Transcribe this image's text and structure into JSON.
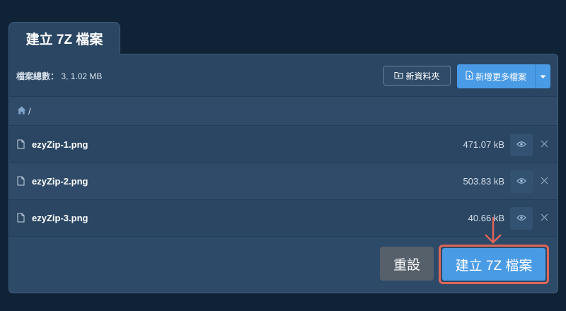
{
  "tab": {
    "title": "建立 7Z 檔案"
  },
  "toolbar": {
    "file_count_label": "檔案總數：",
    "file_count_value": "3, 1.02 MB",
    "new_folder_label": "新資料夾",
    "add_more_label": "新增更多檔案",
    "icons": {
      "new_folder": "folder-plus-icon",
      "add_more": "file-plus-icon",
      "dropdown": "caret-down-icon"
    }
  },
  "breadcrumb": {
    "path": "/",
    "icon": "home-icon"
  },
  "files": [
    {
      "name": "ezyZip-1.png",
      "size": "471.07 kB"
    },
    {
      "name": "ezyZip-2.png",
      "size": "503.83 kB"
    },
    {
      "name": "ezyZip-3.png",
      "size": "40.66 kB"
    }
  ],
  "footer": {
    "reset_label": "重設",
    "create_label": "建立 7Z 檔案"
  },
  "colors": {
    "background": "#102236",
    "panel": "#2d4a68",
    "primary": "#4a9be6",
    "reset": "#56606b",
    "highlight": "#de6559"
  }
}
